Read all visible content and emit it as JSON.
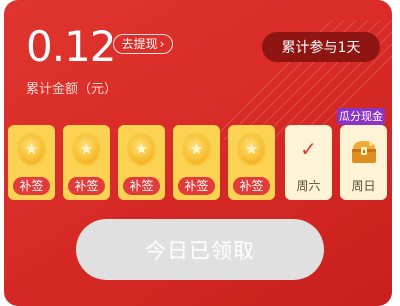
{
  "summary": {
    "amount": "0.12",
    "withdraw_label": "去提现",
    "caption": "累计金额（元）",
    "days_badge": "累计参与1天"
  },
  "days": [
    {
      "label": "补签",
      "state": "makeup"
    },
    {
      "label": "补签",
      "state": "makeup"
    },
    {
      "label": "补签",
      "state": "makeup"
    },
    {
      "label": "补签",
      "state": "makeup"
    },
    {
      "label": "补签",
      "state": "makeup"
    },
    {
      "label": "周六",
      "state": "checked"
    },
    {
      "label": "周日",
      "state": "chest"
    }
  ],
  "bonus_tag": "瓜分现金",
  "claim_button": "今日已领取",
  "colors": {
    "card_red": "#d92b27",
    "badge_dark": "#8f1512",
    "coin_gold": "#f6b828",
    "tag_purple": "#8b35c7",
    "disabled_gray": "#e0e0e0"
  },
  "icons": {
    "coin": "star-coin-icon",
    "check": "checkmark-icon",
    "chest": "treasure-chest-icon",
    "chevron": "chevron-right-icon"
  }
}
